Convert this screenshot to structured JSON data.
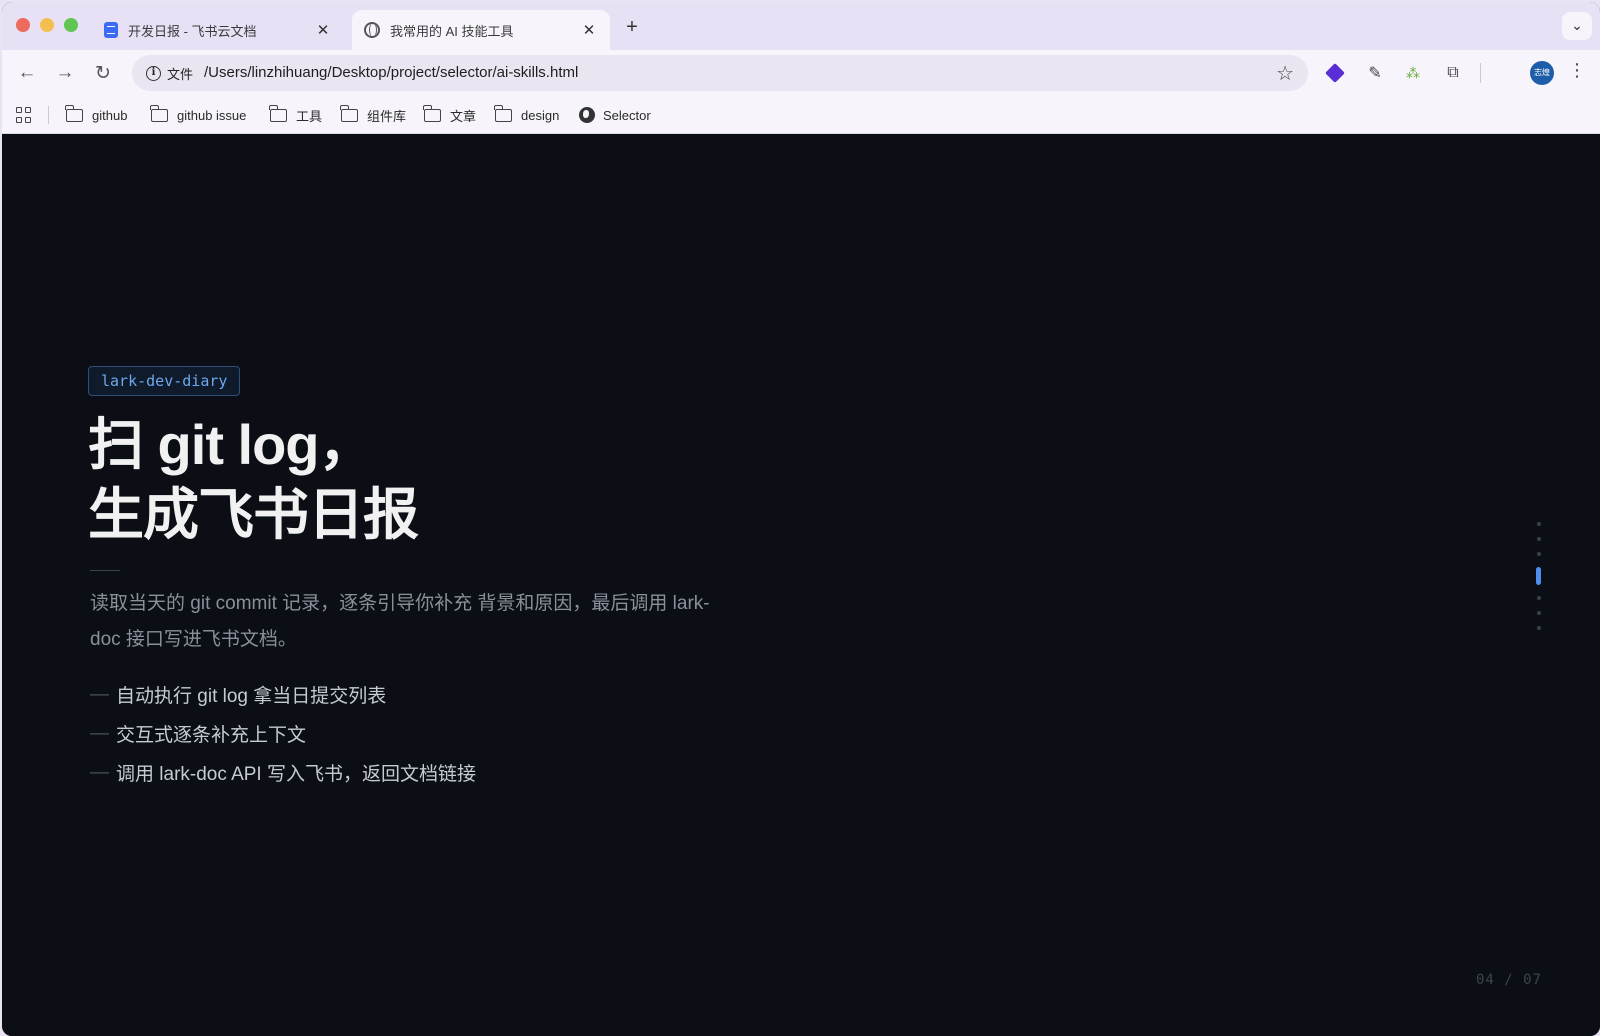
{
  "tabs": [
    {
      "title": "开发日报 - 飞书云文档",
      "icon": "doc-icon",
      "active": false
    },
    {
      "title": "我常用的 AI 技能工具",
      "icon": "globe-icon",
      "active": true
    }
  ],
  "toolbar": {
    "site_chip_label": "文件",
    "url": "/Users/linzhihuang/Desktop/project/selector/ai-skills.html",
    "avatar_text": "志煌"
  },
  "bookmarks": [
    {
      "label": "github",
      "icon": "folder-icon"
    },
    {
      "label": "github issue",
      "icon": "folder-icon"
    },
    {
      "label": "工具",
      "icon": "folder-icon"
    },
    {
      "label": "组件库",
      "icon": "folder-icon"
    },
    {
      "label": "文章",
      "icon": "folder-icon"
    },
    {
      "label": "design",
      "icon": "folder-icon"
    },
    {
      "label": "Selector",
      "icon": "globe-icon"
    }
  ],
  "slide": {
    "tag": "lark-dev-diary",
    "title_line1": "扫 git log，",
    "title_line2": "生成飞书日报",
    "description": "读取当天的 git commit 记录，逐条引导你补充 背景和原因，最后调用 lark-doc 接口写进飞书文档。",
    "bullets": [
      "自动执行 git log 拿当日提交列表",
      "交互式逐条补充上下文",
      "调用 lark-doc API 写入飞书，返回文档链接"
    ],
    "bullet_marker": "—",
    "page_indicator": "04 / 07",
    "nav_dots_total": 7,
    "nav_dots_active": 4
  },
  "colors": {
    "background": "#0b0e15",
    "accent": "#4f8fee",
    "tag_text": "#6ea8ec"
  }
}
